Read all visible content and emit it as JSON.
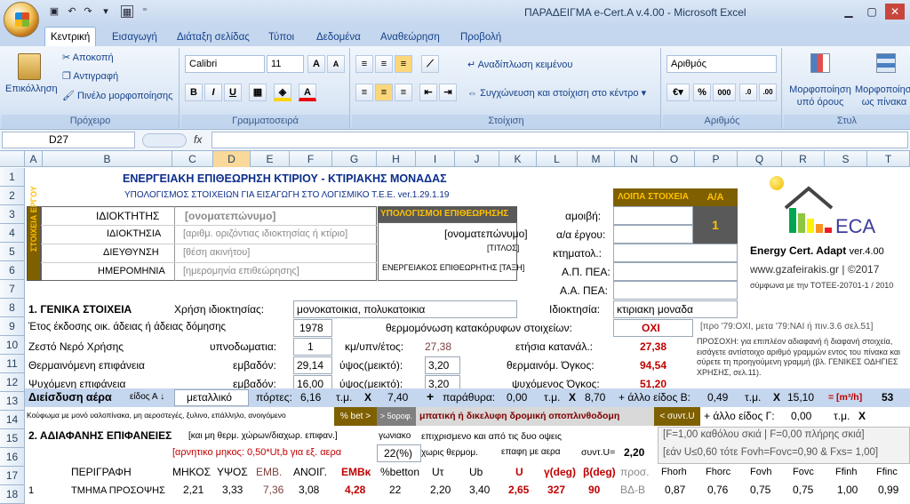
{
  "window": {
    "title": "ΠΑΡΑΔΕΙΓΜΑ e-Cert.A v.4.00  -  Microsoft Excel"
  },
  "tabs": [
    "Κεντρική",
    "Εισαγωγή",
    "Διάταξη σελίδας",
    "Τύποι",
    "Δεδομένα",
    "Αναθεώρηση",
    "Προβολή"
  ],
  "ribbon": {
    "clipboard": {
      "paste": "Επικόλληση",
      "cut": "Αποκοπή",
      "copy": "Αντιγραφή",
      "painter": "Πινέλο μορφοποίησης",
      "label": "Πρόχειρο"
    },
    "font": {
      "name": "Calibri",
      "size": "11",
      "label": "Γραμματοσειρά"
    },
    "alignment": {
      "wrap": "Αναδίπλωση κειμένου",
      "merge": "Συγχώνευση και στοίχιση στο κέντρο",
      "label": "Στοίχιση"
    },
    "number": {
      "format": "Αριθμός",
      "label": "Αριθμός"
    },
    "styles": {
      "cond": "Μορφοποίηση υπό όρους",
      "table": "Μορφοποίηση ως πίνακα",
      "label": "Στυλ"
    }
  },
  "formula": {
    "cell": "D27",
    "fx": "fx"
  },
  "columns": [
    "A",
    "B",
    "C",
    "D",
    "E",
    "F",
    "G",
    "H",
    "I",
    "J",
    "K",
    "L",
    "M",
    "N",
    "O",
    "P",
    "Q",
    "R",
    "S",
    "T"
  ],
  "rows": [
    "1",
    "2",
    "3",
    "4",
    "5",
    "6",
    "7",
    "8",
    "9",
    "10",
    "11",
    "12",
    "13",
    "14",
    "15",
    "16",
    "17",
    "18"
  ],
  "sheet": {
    "r1": "ΕΝΕΡΓΕΙΑΚΗ ΕΠΙΘΕΩΡΗΣΗ ΚΤΙΡΙΟΥ - ΚΤΙΡΙΑΚΗΣ ΜΟΝΑΔΑΣ",
    "r2": "ΥΠΟΛΟΓΙΣΜΟΣ ΣΤΟΙΧΕΙΩΝ ΓΙΑ ΕΙΣΑΓΩΓΗ ΣΤΟ ΛΟΓΙΣΜΙΚΟ Τ.Ε.Ε. ver.1.29.1.19",
    "vert": "ΣΤΟΙΧΕΙΑ ΕΡΓΟΥ",
    "owner_lbl": "ΙΔΙΟΚΤΗΤΗΣ",
    "owner_val": "[ονοματεπώνυμο]",
    "own_lbl": "ΙΔΙΟΚΤΗΣΙΑ",
    "own_val": "[αριθμ. οριζόντιας ιδιοκτησίας ή κτίριο]",
    "addr_lbl": "ΔΙΕΥΘΥΝΣΗ",
    "addr_val": "[θέση ακινήτου]",
    "date_lbl": "ΗΜΕΡΟΜΗΝΙΑ",
    "date_val": "[ημερομηνία επιθεώρησης]",
    "insp_hdr": "ΥΠΟΛΟΓΙΣΜΟΙ ΕΠΙΘΕΩΡΗΣΗΣ",
    "insp_name": "[ονοματεπώνυμο]",
    "insp_title": "[ΤΙΤΛΟΣ]",
    "insp_class": "ΕΝΕΡΓΕΙΑΚΟΣ ΕΠΙΘΕΩΡΗΤΗΣ [ΤΑΞΗ]",
    "other_hdr": "ΛΟΙΠΑ ΣΤΟΙΧΕΙΑ",
    "aa_hdr": "Α/Α",
    "aa_val": "1",
    "fee": "αμοιβή:",
    "proj": "α/α έργου:",
    "ktim": "κτηματολ.:",
    "ap": "Α.Π. ΠΕΑ:",
    "aa_pea": "Α.Α. ΠΕΑ:",
    "logo1": "Energy Cert. Adapt",
    "logo_ver": "ver.4.00",
    "logo_url": "www.gzafeirakis.gr",
    "logo_c": "| ©2017",
    "logo_sub": "σύμφωνα με την ΤΟΤΕΕ-20701-1 / 2010",
    "eca": "ECA",
    "s1": "1. ΓΕΝΙΚΑ ΣΤΟΙΧΕΙΑ",
    "use_lbl": "Χρήση ιδιοκτησίας:",
    "use_val": "μονοκατοικια, πολυκατοικια",
    "prop_lbl": "Ιδιοκτησία:",
    "prop_val": "κτιριακη μοναδα",
    "year_lbl": "Έτος έκδοσης οικ. άδειας ή άδειας δόμησης",
    "year_val": "1978",
    "ins_lbl": "θερμομόνωση κατακόρυφων στοιχείων:",
    "ins_val": "ΟΧΙ",
    "ins_note": "[προ '79:ΟΧΙ, μετα '79:ΝΑΙ ή πιν.3.6 σελ.51]",
    "dhw_lbl": "Ζεστό Νερό Χρήσης",
    "rooms_lbl": "υπνοδωματια:",
    "rooms_val": "1",
    "kmy_lbl": "κμ/υπν/έτος:",
    "kmy_val": "27,38",
    "ann_lbl": "ετήσια κατανάλ.:",
    "ann_val": "27,38",
    "heat_lbl": "Θερμαινόμενη επιφάνεια",
    "area_lbl": "εμβαδόν:",
    "harea": "29,14",
    "h_lbl": "ύψος(μεικτό):",
    "hh": "3,20",
    "hvol_lbl": "θερμαινόμ. Όγκος:",
    "hvol": "94,54",
    "cool_lbl": "Ψυχόμενη επιφάνεια",
    "carea": "16,00",
    "ch": "3,20",
    "cvol_lbl": "ψυχόμενος Όγκος:",
    "cvol": "51,20",
    "note": "ΠΡΟΣΟΧΗ: για επιπλέον αδιαφανή ή διαφανή στοιχεία, εισάγετε αντίστοιχο αριθμό γραμμών εντος του πίνακα και σύρετε τη προηγούμενη γραμμή (βλ. ΓΕΝΙΚΕΣ ΟΔΗΓΙΕΣ ΧΡΗΣΗΣ, σελ.11).",
    "air_lbl": "Διείσδυση αέρα",
    "type_a": "είδος Α",
    "metal": "μεταλλικό",
    "doors": "πόρτες:",
    "d1": "6,16",
    "tm": "τ.μ.",
    "x": "X",
    "d2": "7,40",
    "plus": "+",
    "wins": "παράθυρα:",
    "w1": "0,00",
    "w2": "8,70",
    "otherB": "+ άλλο είδος Β:",
    "b1": "0,49",
    "b2": "15,10",
    "eq": "= [m³/h]",
    "total": "53",
    "r14a": "Κούφωμα με μονό υαλοπίνακα, μη αεροστεγές, ξυλινο, επάλληλο, ανοιγόμενο",
    "pbet": "% bet >",
    "floors": "> 5οροφ.",
    "r14m": "μπατική ή δικελυφη δρομική οποπλινθοδομη",
    "sunt": "< συντ.U",
    "otherG": "+ άλλο είδος Γ:",
    "g1": "0,00",
    "s2": "2. ΑΔΙΑΦΑΝΗΣ ΕΠΙΦΑΝΕΙΕΣ",
    "s2n": "[και μη θερμ. χώρων/διαχωρ. επιφαν.]",
    "gonia": "γωνιακο",
    "r15m": "επιχρισμενο και από τις δυο οψεις",
    "fnote1": "[F=1,00 καθόλου σκιά | F=0,00 πλήρης σκιά]",
    "neg": "[αρνητικο μηκος: 0,50*Ut,b για εξ. αερα",
    "pct": "22(%)",
    "noinsul": "χωρις θερμομ.",
    "contact": "επαφη με αερα",
    "suntU": "συντ.U=",
    "u_val": "2,20",
    "fnote2": "[εάν U≤0,60 τότε Fovh=Fovc=0,90 & Fxs= 1,00]",
    "h_per": "ΠΕΡΙΓΡΑΦΗ",
    "h_len": "ΜΗΚΟΣ",
    "h_hei": "ΥΨΟΣ",
    "h_emb": "ΕΜΒ.",
    "h_open": "ΑΝΟΙΓ.",
    "h_embk": "ΕΜΒκ",
    "h_bet": "%betton",
    "h_ut": "Uτ",
    "h_ub": "Ub",
    "h_u": "U",
    "h_g": "γ(deg)",
    "h_b": "β(deg)",
    "h_pros": "προσ.",
    "h_fh1": "Fhorh",
    "h_fh2": "Fhorc",
    "h_fo1": "Fovh",
    "h_fo2": "Fovc",
    "h_fi1": "Ffinh",
    "h_fi2": "Ffinc",
    "r18": [
      "1",
      "ΤΜΗΜΑ ΠΡΟΣΟΨΗΣ",
      "2,21",
      "3,33",
      "7,36",
      "3,08",
      "4,28",
      "22",
      "2,20",
      "3,40",
      "2,65",
      "327",
      "90",
      "ΒΔ-Β",
      "0,87",
      "0,76",
      "0,75",
      "0,75",
      "1,00",
      "0,99"
    ]
  }
}
